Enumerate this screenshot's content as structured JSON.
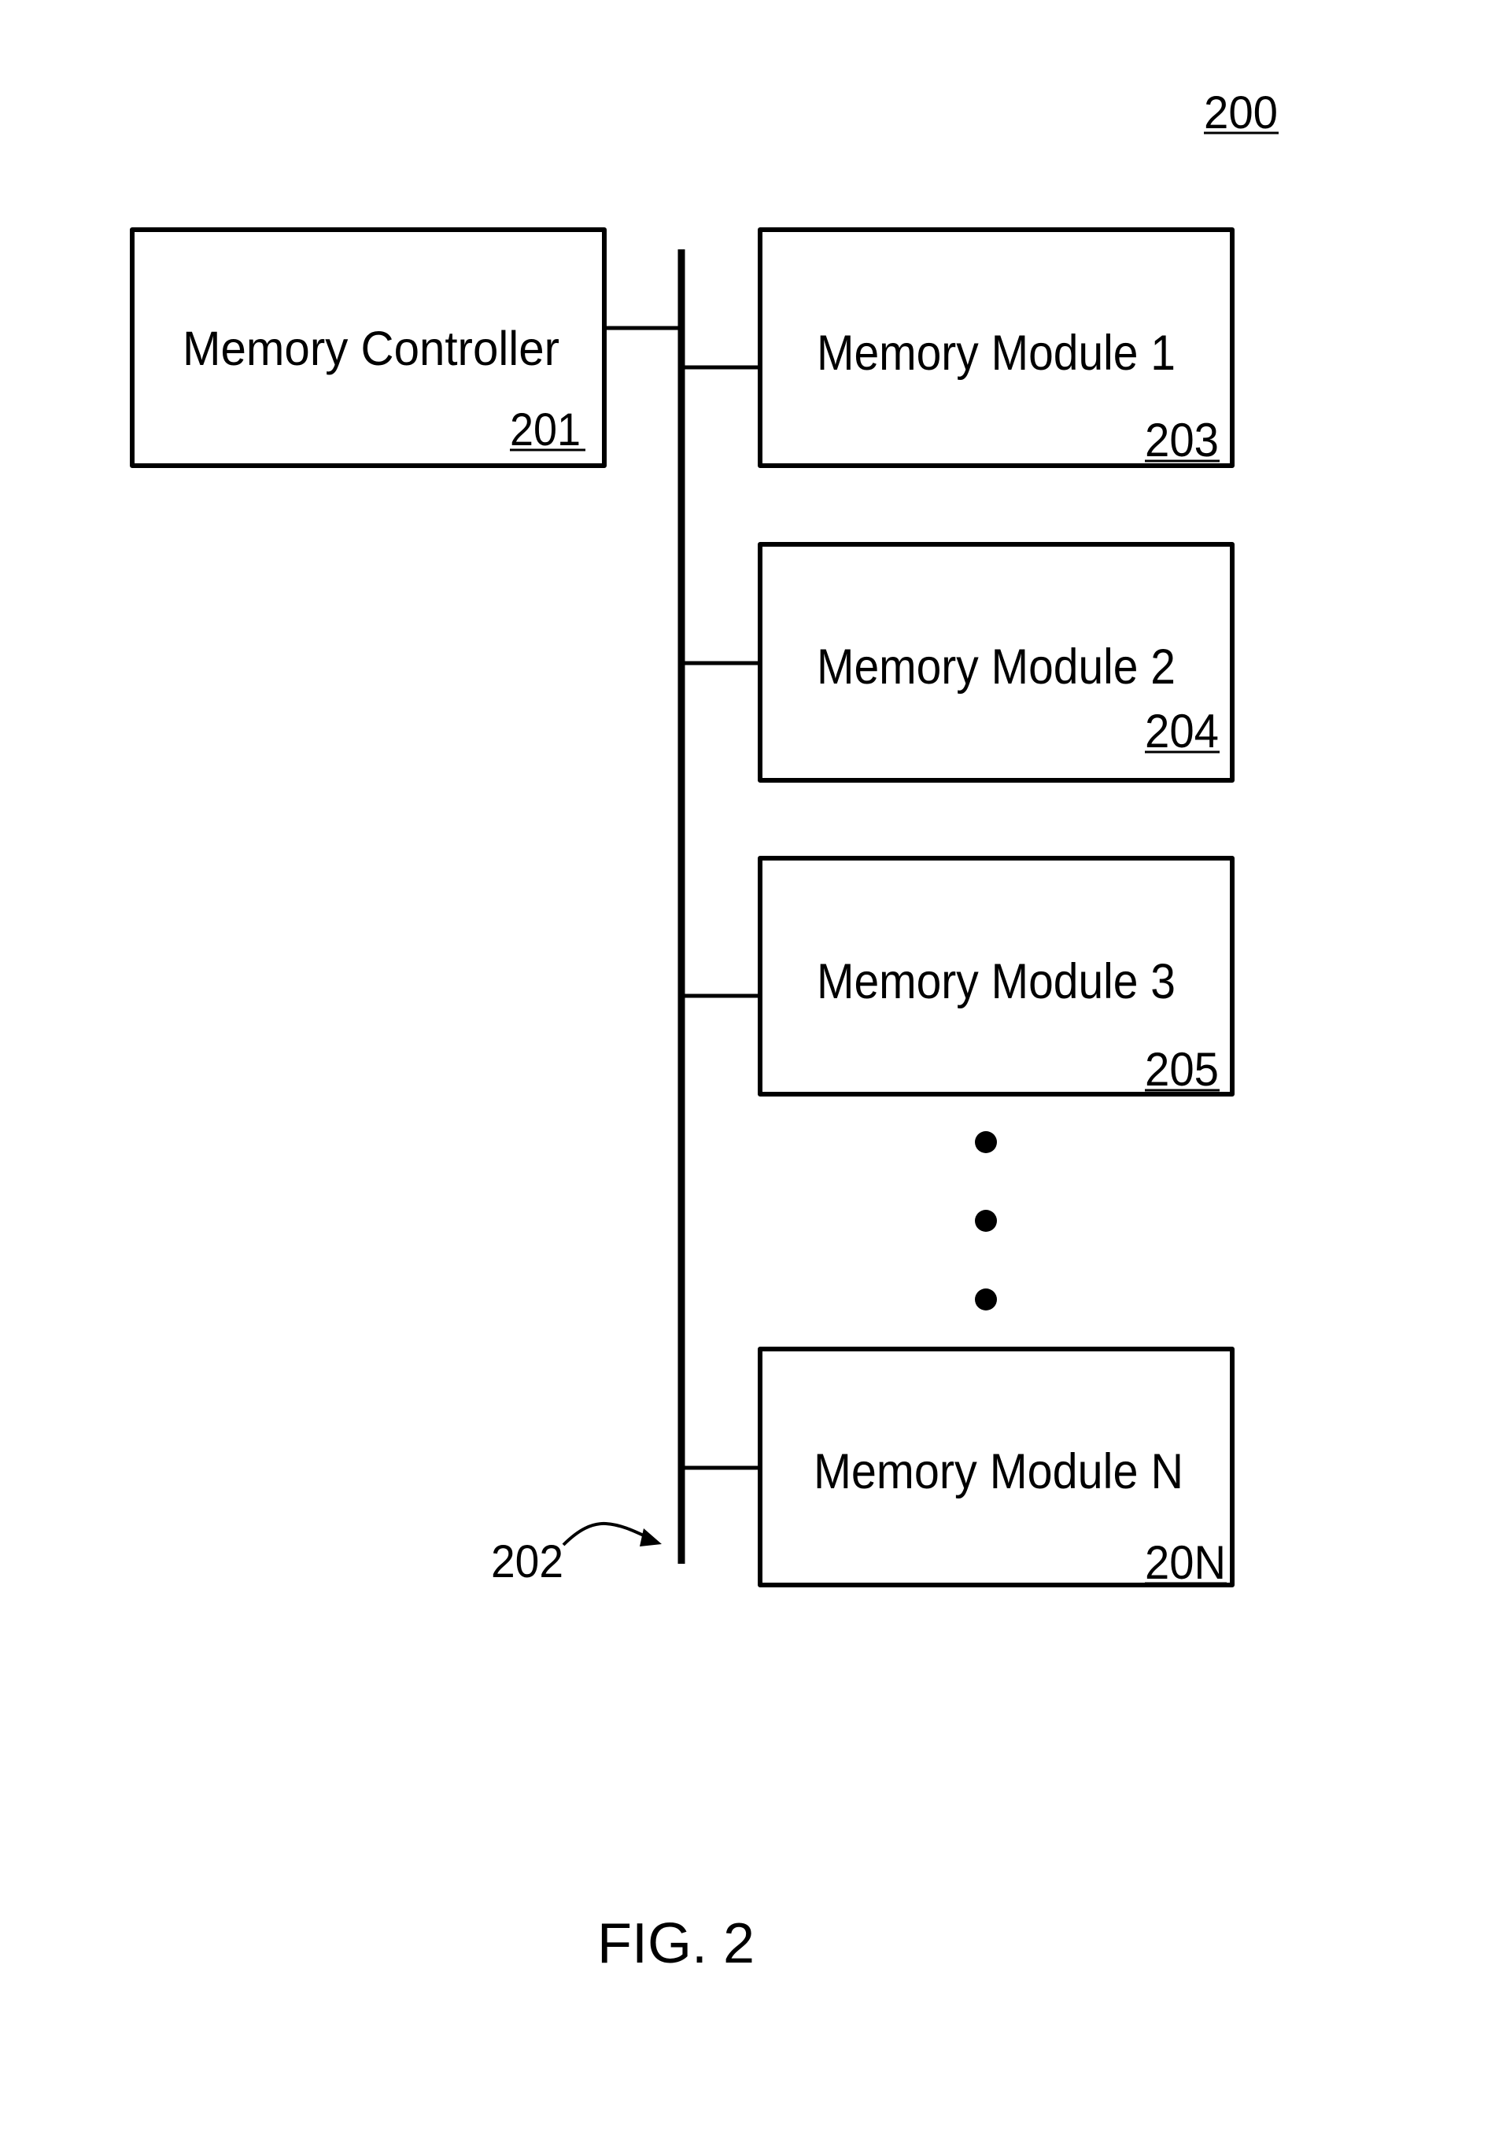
{
  "figure": {
    "reference_number": "200",
    "caption": "FIG. 2"
  },
  "colors": {
    "line": "#000000",
    "background": "#ffffff"
  },
  "controller": {
    "title": "Memory Controller",
    "ref": "201"
  },
  "bus": {
    "ref": "202"
  },
  "modules": [
    {
      "title": "Memory Module 1",
      "ref": "203"
    },
    {
      "title": "Memory Module 2",
      "ref": "204"
    },
    {
      "title": "Memory Module 3",
      "ref": "205"
    },
    {
      "title": "Memory Module N",
      "ref": "20N"
    }
  ],
  "ellipsis": {
    "dot_count": 3,
    "meaning": "additional memory modules omitted"
  }
}
